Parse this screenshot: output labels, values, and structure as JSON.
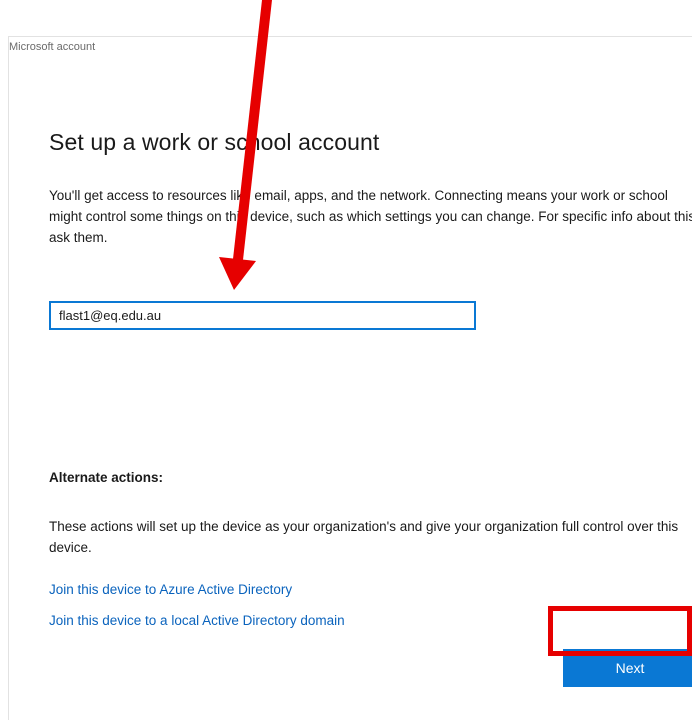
{
  "window": {
    "title": "Microsoft account"
  },
  "main": {
    "title": "Set up a work or school account",
    "description": "You'll get access to resources like email, apps, and the network. Connecting means your work or school might control some things on this device, such as which settings you can change. For specific info about this, ask them.",
    "email_value": "flast1@eq.edu.au"
  },
  "alternate": {
    "heading": "Alternate actions:",
    "text": "These actions will set up the device as your organization's and give your organization full control over this device.",
    "links": [
      {
        "label": "Join this device to Azure Active Directory"
      },
      {
        "label": "Join this device to a local Active Directory domain"
      }
    ]
  },
  "footer": {
    "next_label": "Next"
  },
  "colors": {
    "accent": "#0a78d4",
    "link": "#0a63bd",
    "annotation": "#e60000"
  },
  "annotations": {
    "pointer_arrow": "red-arrow-icon",
    "highlight": "red-highlight-box"
  }
}
